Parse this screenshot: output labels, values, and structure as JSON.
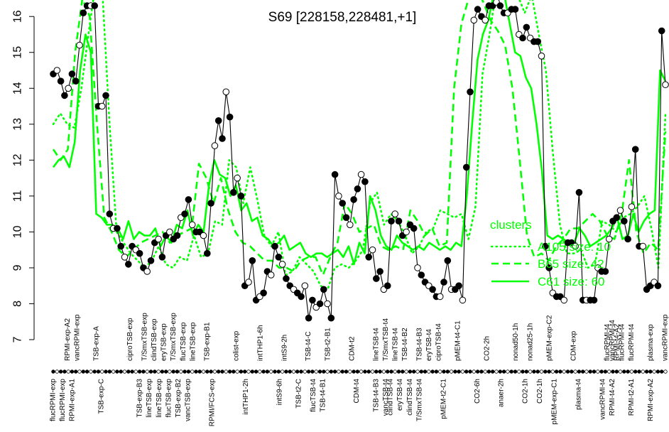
{
  "chart_data": {
    "type": "line",
    "title": "S69 [228158,228481,+1]",
    "xlabel": "",
    "ylabel": "",
    "ylim": [
      7,
      16.4
    ],
    "yticks": [
      7,
      8,
      9,
      10,
      11,
      12,
      13,
      14,
      15,
      16
    ],
    "grid": false,
    "legend": {
      "title": "clusters",
      "placement": "right",
      "entries": [
        {
          "label": "A105 size: 10",
          "style": "dotted"
        },
        {
          "label": "B65 size: 42",
          "style": "dashed"
        },
        {
          "label": "C61 size: 60",
          "style": "solid"
        }
      ]
    },
    "colors": {
      "cluster_lines": "#00ff00",
      "main_line": "#000000",
      "axis": "#000000"
    },
    "top_labels": [
      {
        "label": "RPMI-exp-A2",
        "idx": 3
      },
      {
        "label": "vancRPMI-exp",
        "idx": 5
      },
      {
        "label": "TSB-exp-A",
        "idx": 9
      },
      {
        "label": "ciproTSB-exp",
        "idx": 16
      },
      {
        "label": "T/SmxTSB-exp",
        "idx": 19
      },
      {
        "label": "clindTSB-exp",
        "idx": 21
      },
      {
        "label": "eryTSB-exp",
        "idx": 23
      },
      {
        "label": "T/SmxTSB-exp",
        "idx": 25
      },
      {
        "label": "flucTSB-exp",
        "idx": 27
      },
      {
        "label": "lineTSB-exp",
        "idx": 29
      },
      {
        "label": "TSB-exp-B1",
        "idx": 32
      },
      {
        "label": "colist-exp",
        "idx": 38
      },
      {
        "label": "intTHP1-6h",
        "idx": 43
      },
      {
        "label": "intS9-2h",
        "idx": 48
      },
      {
        "label": "TSB-t4-C",
        "idx": 53
      },
      {
        "label": "TSB-t2-B1",
        "idx": 57
      },
      {
        "label": "CDM-t2",
        "idx": 62
      },
      {
        "label": "lineTSB-t4",
        "idx": 67
      },
      {
        "label": "T/SmxTSB-t4",
        "idx": 69
      },
      {
        "label": "lineTSB-t4",
        "idx": 71
      },
      {
        "label": "TSB-t4-B2",
        "idx": 73
      },
      {
        "label": "TSB-t4-B3",
        "idx": 76
      },
      {
        "label": "eryTSB-t4",
        "idx": 78
      },
      {
        "label": "ciproTSB-t4",
        "idx": 80
      },
      {
        "label": "pMEM-t4-C1",
        "idx": 84
      },
      {
        "label": "CO2-2h",
        "idx": 90
      },
      {
        "label": "nonad50-1h",
        "idx": 96
      },
      {
        "label": "nonad25-1h",
        "idx": 99
      },
      {
        "label": "pMEM-exp-C2",
        "idx": 103
      },
      {
        "label": "CDM-exp",
        "idx": 108
      },
      {
        "label": "flucRPMI-t4",
        "idx": 115
      },
      {
        "label": "vancRPMI-t4",
        "idx": 116
      },
      {
        "label": "RPMI-t4-A2",
        "idx": 117
      },
      {
        "label": "flucRPMI-t4",
        "idx": 118
      },
      {
        "label": "flucRPMI-t4",
        "idx": 120
      },
      {
        "label": "plasma-exp",
        "idx": 124
      },
      {
        "label": "vancRPMI-exp",
        "idx": 127
      }
    ],
    "bottom_labels": [
      {
        "label": "flucRPMI-exp",
        "idx": 0
      },
      {
        "label": "flucRPMI-exp",
        "idx": 2
      },
      {
        "label": "RPMI-exp-A1",
        "idx": 4
      },
      {
        "label": "TSB-exp-C",
        "idx": 10
      },
      {
        "label": "TSB-exp-B3",
        "idx": 18
      },
      {
        "label": "lineTSB-exp",
        "idx": 20
      },
      {
        "label": "lineTSB-exp",
        "idx": 22
      },
      {
        "label": "flucTSB-exp",
        "idx": 24
      },
      {
        "label": "TSB-exp-B2",
        "idx": 26
      },
      {
        "label": "vancTSB-exp",
        "idx": 28
      },
      {
        "label": "RPMI/FCS-exp",
        "idx": 33
      },
      {
        "label": "intTHP1-2h",
        "idx": 40
      },
      {
        "label": "intS9-6h",
        "idx": 47
      },
      {
        "label": "TSB-t2-C",
        "idx": 51
      },
      {
        "label": "flucTSB-t4",
        "idx": 54
      },
      {
        "label": "TSB-t4-B1",
        "idx": 56
      },
      {
        "label": "CDM-t4",
        "idx": 63
      },
      {
        "label": "TSB-t4-B3",
        "idx": 67
      },
      {
        "label": "vancTSB-t4",
        "idx": 69
      },
      {
        "label": "clindTSB-t4",
        "idx": 70
      },
      {
        "label": "eryTSB-t4",
        "idx": 72
      },
      {
        "label": "clindTSB-t4",
        "idx": 74
      },
      {
        "label": "T/SmxTSB-t4",
        "idx": 76
      },
      {
        "label": "pMEM-t2-C1",
        "idx": 81
      },
      {
        "label": "CO2-6h",
        "idx": 88
      },
      {
        "label": "anaer-2h",
        "idx": 93
      },
      {
        "label": "CO2-1h",
        "idx": 98
      },
      {
        "label": "CO2-1h",
        "idx": 101
      },
      {
        "label": "pMEM-exp-C1",
        "idx": 104
      },
      {
        "label": "plasma-t4",
        "idx": 109
      },
      {
        "label": "vancRPMI-t4",
        "idx": 114
      },
      {
        "label": "RPMI-t4-A2",
        "idx": 116
      },
      {
        "label": "RPMI-t2-A1",
        "idx": 120
      },
      {
        "label": "RPMI-exp-A2",
        "idx": 124
      }
    ],
    "series": [
      {
        "style": "main",
        "values": [
          14.4,
          14.5,
          14.2,
          13.8,
          14.0,
          14.4,
          14.2,
          15.2,
          16.1,
          16.3,
          16.3,
          16.3,
          13.5,
          13.5,
          13.8,
          10.5,
          10.1,
          10.1,
          9.6,
          9.3,
          9.1,
          9.6,
          9.5,
          9.4,
          9.0,
          8.9,
          9.2,
          9.7,
          9.8,
          9.3,
          9.9,
          10.0,
          9.8,
          9.9,
          10.4,
          10.5,
          10.9,
          10.2,
          10.0,
          10.0,
          9.9,
          9.4,
          10.8,
          12.4,
          13.1,
          12.6,
          13.9,
          13.2,
          11.1,
          11.5,
          11.0,
          8.5,
          8.6,
          9.2,
          8.1,
          8.2,
          8.3,
          8.9,
          8.8,
          9.6,
          9.3,
          9.1,
          8.7,
          8.5,
          8.4,
          8.3,
          8.2,
          8.5,
          7.6,
          8.1,
          7.9,
          8.0,
          8.4,
          8.0,
          7.6,
          11.6,
          11.0,
          10.8,
          10.4,
          10.2,
          10.9,
          11.2,
          11.6,
          11.4,
          9.3,
          9.5,
          8.7,
          8.9,
          8.4,
          8.5,
          10.3,
          10.5,
          10.3,
          9.9,
          10.0,
          10.2,
          10.1,
          9.0,
          8.8,
          8.6,
          8.5,
          8.4,
          8.2,
          8.2,
          8.6,
          9.2,
          8.4,
          8.4,
          8.5,
          8.1,
          11.8,
          13.9,
          15.9,
          16.2,
          16.0,
          15.9,
          16.3,
          16.3,
          16.4,
          16.3,
          16.1,
          16.1,
          16.2,
          16.2,
          15.5,
          15.4,
          15.7,
          15.4,
          15.3,
          15.3,
          14.9,
          9.6,
          9.0,
          8.3,
          8.2,
          8.2,
          8.1,
          9.7,
          9.7,
          9.6,
          11.1,
          8.1,
          8.1,
          8.1,
          8.1,
          9.0,
          8.9,
          8.9,
          9.8,
          10.3,
          10.4,
          10.6,
          10.3,
          9.8,
          10.7,
          12.3,
          9.6,
          9.6,
          8.4,
          8.5,
          8.6,
          8.5,
          15.6,
          14.1
        ]
      },
      {
        "name": "A105 size: 10",
        "style": "dotted",
        "values": [
          13.0,
          13.3,
          13.0,
          12.9,
          14.0,
          15.5,
          16.9,
          16.6,
          13.0,
          10.0,
          9.7,
          9.4,
          9.2,
          9.0,
          9.2,
          9.6,
          9.1,
          9.0,
          9.3,
          9.2,
          9.9,
          9.3,
          9.4,
          10.3,
          10.2,
          12.0,
          11.8,
          10.8,
          11.8,
          10.9,
          9.9,
          9.6,
          10.0,
          8.8,
          8.9,
          9.3,
          9.1,
          8.9,
          8.5,
          8.4,
          9.0,
          9.1,
          9.0,
          9.2,
          9.5,
          10.8,
          11.1,
          10.2,
          10.5,
          10.3,
          9.9,
          9.4,
          9.6,
          10.0,
          10.1,
          10.6,
          10.5,
          10.4,
          10.5,
          9.8,
          10.7,
          14.4,
          15.5,
          16.8,
          17.4,
          16.9,
          16.6,
          16.1,
          16.6,
          15.5,
          14.5,
          12.2,
          10.2,
          9.4,
          9.4,
          9.5,
          9.0,
          9.1,
          10.3,
          10.2,
          10.0,
          10.4,
          10.5,
          10.7,
          11.0,
          10.1,
          9.0,
          13.3
        ]
      },
      {
        "name": "B65 size: 42",
        "style": "dashed",
        "values": [
          12.3,
          12.0,
          12.3,
          15.0,
          16.5,
          16.0,
          13.0,
          10.4,
          10.0,
          9.5,
          9.3,
          9.5,
          9.7,
          9.8,
          9.9,
          10.0,
          9.7,
          9.9,
          10.0,
          10.1,
          11.9,
          11.5,
          10.8,
          11.5,
          10.6,
          10.0,
          9.7,
          9.6,
          9.4,
          9.2,
          9.2,
          9.0,
          9.0,
          8.9,
          9.2,
          9.3,
          9.3,
          8.8,
          9.3,
          9.7,
          10.8,
          10.5,
          10.0,
          10.1,
          10.2,
          9.6,
          9.5,
          9.6,
          9.5,
          10.6,
          10.3,
          9.9,
          10.1,
          9.6,
          9.7,
          14.0,
          15.8,
          16.5,
          16.8,
          16.4,
          15.9,
          15.6,
          15.2,
          14.0,
          12.0,
          9.9,
          9.3,
          9.4,
          9.2,
          9.6,
          9.8,
          10.1,
          10.1,
          10.3,
          10.5,
          10.3,
          9.9,
          9.8,
          10.5,
          12.0,
          10.0,
          9.4,
          9.7,
          9.5,
          12.8
        ]
      },
      {
        "name": "C61 size: 60",
        "style": "solid",
        "values": [
          11.8,
          12.0,
          12.1,
          11.8,
          12.5,
          14.5,
          15.5,
          15.0,
          10.5,
          10.4,
          10.2,
          10.2,
          10.1,
          9.8,
          10.3,
          9.8,
          10.0,
          9.9,
          9.9,
          10.1,
          9.6,
          9.9,
          9.7,
          10.2,
          10.1,
          10.6,
          9.9,
          10.2,
          10.0,
          11.3,
          12.0,
          11.6,
          11.5,
          11.0,
          11.3,
          10.6,
          10.8,
          10.3,
          10.4,
          9.9,
          9.8,
          9.6,
          9.7,
          9.9,
          9.5,
          9.6,
          9.7,
          9.4,
          9.3,
          9.4,
          9.4,
          9.3,
          9.4,
          9.5,
          9.3,
          9.6,
          9.1,
          9.7,
          9.4,
          11.0,
          10.6,
          9.9,
          9.6,
          9.5,
          9.9,
          9.7,
          9.6,
          9.5,
          9.6,
          9.5,
          9.7,
          9.6,
          9.5,
          9.6,
          9.5,
          9.7,
          9.6,
          11.0,
          13.0,
          14.8,
          15.5,
          15.9,
          16.6,
          17.5,
          16.6,
          15.8,
          15.0,
          14.9,
          14.3,
          14.0,
          13.0,
          11.7,
          9.9,
          9.8,
          9.9,
          9.8,
          9.7,
          9.7,
          10.1,
          9.9,
          9.6,
          9.7,
          9.8,
          9.9,
          10.1,
          10.4,
          9.8,
          9.9,
          10.5,
          10.0,
          10.3,
          10.5,
          10.6,
          14.5,
          14.2
        ]
      }
    ]
  }
}
